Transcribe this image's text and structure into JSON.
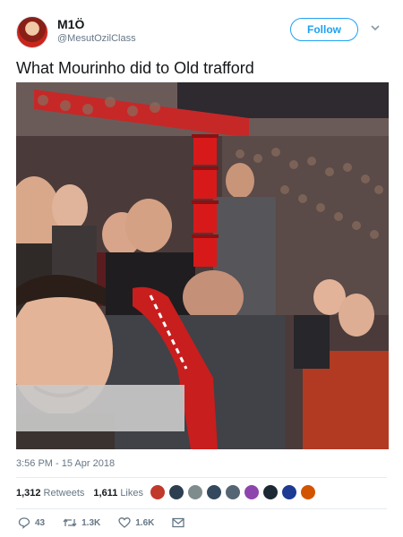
{
  "user": {
    "display_name": "M1Ö",
    "handle": "@MesutOzilClass",
    "follow_label": "Follow"
  },
  "tweet": {
    "text": "What Mourinho did to Old trafford",
    "timestamp": "3:56 PM - 15 Apr 2018"
  },
  "stats": {
    "retweets_count": "1,312",
    "retweets_label": "Retweets",
    "likes_count": "1,611",
    "likes_label": "Likes"
  },
  "likers": [
    {
      "color": "#c0392b"
    },
    {
      "color": "#2c3e50"
    },
    {
      "color": "#7f8c8d"
    },
    {
      "color": "#34495e"
    },
    {
      "color": "#566573"
    },
    {
      "color": "#8e44ad"
    },
    {
      "color": "#1c2833"
    },
    {
      "color": "#1f3a93"
    },
    {
      "color": "#d35400"
    }
  ],
  "actions": {
    "reply_count": "43",
    "retweet_count": "1.3K",
    "like_count": "1.6K"
  },
  "colors": {
    "accent": "#1da1f2",
    "muted": "#657786",
    "text": "#14171a"
  },
  "icons": {
    "caret": "chevron-down-icon",
    "reply": "reply-icon",
    "retweet": "retweet-icon",
    "like": "heart-icon",
    "dm": "envelope-icon"
  }
}
